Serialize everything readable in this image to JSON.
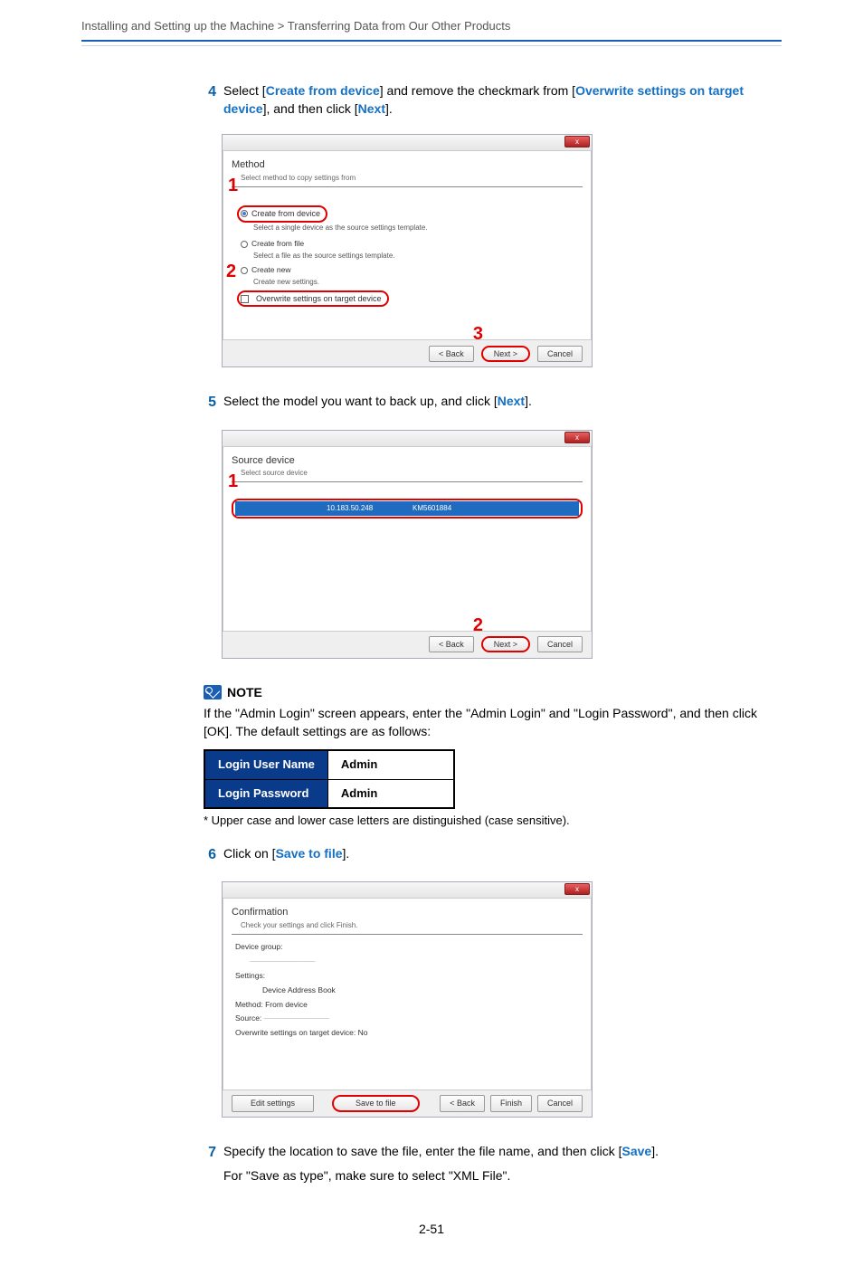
{
  "breadcrumb": "Installing and Setting up the Machine > Transferring Data from Our Other Products",
  "step4": {
    "num": "4",
    "pre1": "Select [",
    "kw1": "Create from device",
    "mid1": "] and remove the checkmark from [",
    "kw2": "Overwrite settings on target device",
    "mid2": "], and then click [",
    "kw3": "Next",
    "post": "]."
  },
  "dlg1": {
    "heading": "Method",
    "sub": "Select method to copy settings from",
    "r1": "Create from device",
    "r1d": "Select a single device as the source settings template.",
    "r2": "Create from file",
    "r2d": "Select a file as the source settings template.",
    "r3": "Create new",
    "r3d": "Create new settings.",
    "chk": "Overwrite settings on target device",
    "back": "< Back",
    "next": "Next >",
    "cancel": "Cancel",
    "ann1": "1",
    "ann2": "2",
    "ann3": "3"
  },
  "step5": {
    "num": "5",
    "pre1": "Select the model you want to back up, and click [",
    "kw1": "Next",
    "post": "]."
  },
  "dlg2": {
    "heading": "Source device",
    "sub": "Select source device",
    "ip": "10.183.50.248",
    "serial": "KM5601884",
    "back": "< Back",
    "next": "Next >",
    "cancel": "Cancel",
    "ann1": "1",
    "ann2": "2"
  },
  "note": {
    "label": "NOTE",
    "line1": "If the \"Admin Login\" screen appears, enter the \"Admin Login\" and \"Login Password\", and then click [",
    "kw": "OK",
    "line2": "]. The default settings are as follows:"
  },
  "loginTable": {
    "h1": "Login User Name",
    "v1": "Admin",
    "h2": "Login Password",
    "v2": "Admin"
  },
  "footnote": "* Upper case and lower case letters are distinguished (case sensitive).",
  "step6": {
    "num": "6",
    "pre1": "Click on [",
    "kw1": "Save to file",
    "post": "]."
  },
  "dlg3": {
    "heading": "Confirmation",
    "sub": "Check your settings and click Finish.",
    "l1": "Device group:",
    "l2": "Settings:",
    "l2b": "Device Address Book",
    "l3": "Method: From device",
    "l4": "Source:",
    "l5": "Overwrite settings on target device: No",
    "edit": "Edit settings",
    "save": "Save to file",
    "back": "< Back",
    "finish": "Finish",
    "cancel": "Cancel"
  },
  "step7": {
    "num": "7",
    "text_pre": "Specify the location to save the file, enter the file name, and then click [",
    "kw": "Save",
    "text_post": "].",
    "sub": "For \"Save as type\", make sure to select \"XML File\"."
  },
  "pageNum": "2-51"
}
